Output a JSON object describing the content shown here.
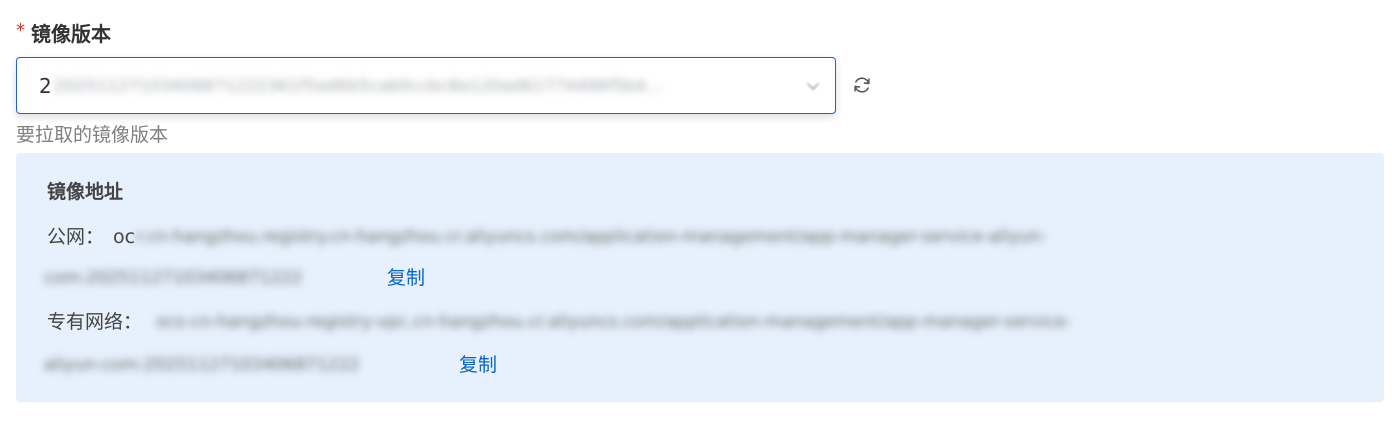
{
  "form": {
    "required_mark": "*",
    "field_label": "镜像版本",
    "select_prefix": "2",
    "select_value": "20251127103406871222361f5ad6b5cab0ccbc8e120ad61774496f5b4...",
    "help_text": "要拉取的镜像版本"
  },
  "image_address": {
    "title": "镜像地址",
    "public": {
      "label": "公网：",
      "address_start": "oc",
      "address_line1": "r.cn-hangzhou.registry.cn-hangzhou.cr.aliyuncs.com/application-management/app-manager-service-aliyun-",
      "address_line2": "com:20251127103406871222",
      "copy_label": "复制"
    },
    "vpc": {
      "label": "专有网络：",
      "address_line1": "ocs-cn-hangzhou-registry-vpc.cn-hangzhou.cr.aliyuncs.com/application-management/app-manager-service-",
      "address_line2": "aliyun-com:20251127103406871222",
      "copy_label": "复制"
    }
  },
  "colors": {
    "primary": "#1f62d6",
    "link": "#0a64c8",
    "required": "#d93026",
    "panel_bg": "#e6f1fd"
  }
}
